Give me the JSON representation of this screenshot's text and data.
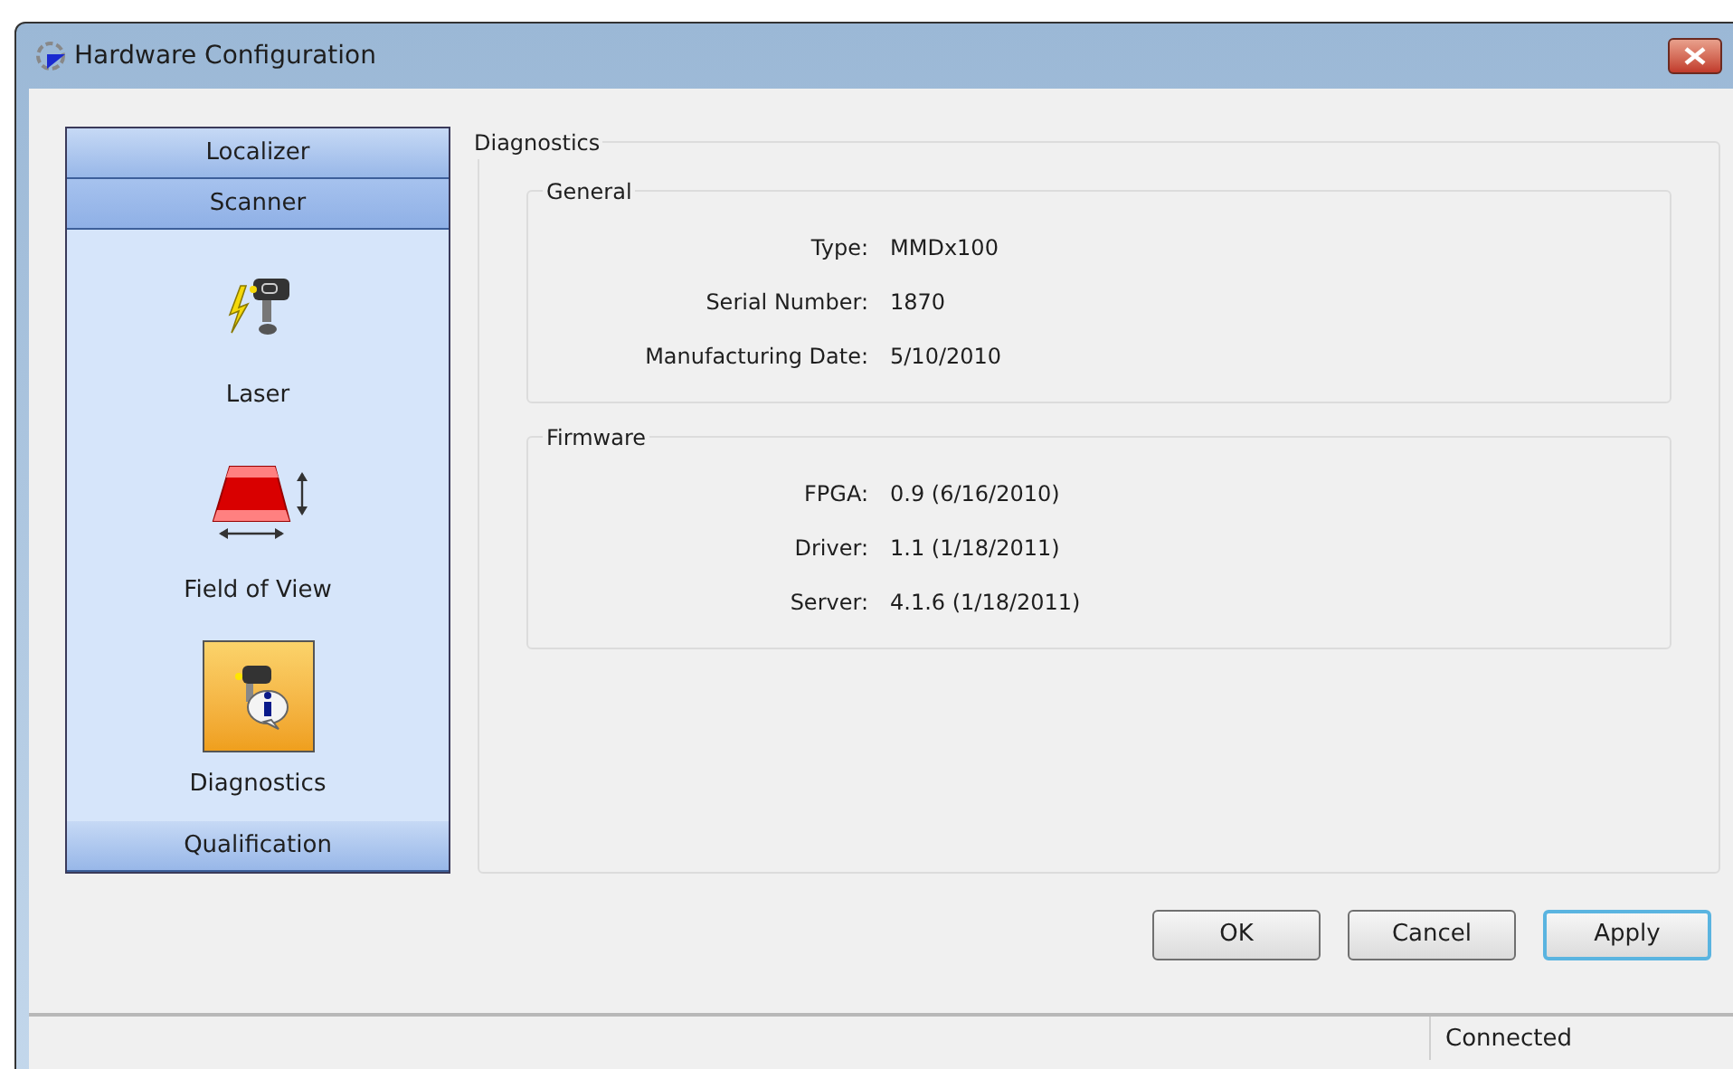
{
  "window": {
    "title": "Hardware Configuration"
  },
  "sidebar": {
    "sections": [
      {
        "label": "Localizer",
        "expanded": false
      },
      {
        "label": "Scanner",
        "expanded": true,
        "items": [
          {
            "label": "Laser",
            "kind": "laser",
            "selected": false
          },
          {
            "label": "Field of View",
            "kind": "field",
            "selected": false
          },
          {
            "label": "Diagnostics",
            "kind": "diagnostics",
            "selected": true
          }
        ]
      },
      {
        "label": "Qualification",
        "expanded": false
      }
    ]
  },
  "panel": {
    "title": "Diagnostics",
    "groups": [
      {
        "title": "General",
        "rows": [
          {
            "label": "Type:",
            "value": "MMDx100"
          },
          {
            "label": "Serial Number:",
            "value": "1870"
          },
          {
            "label": "Manufacturing Date:",
            "value": "5/10/2010"
          }
        ]
      },
      {
        "title": "Firmware",
        "rows": [
          {
            "label": "FPGA:",
            "value": "0.9 (6/16/2010)"
          },
          {
            "label": "Driver:",
            "value": "1.1 (1/18/2011)"
          },
          {
            "label": "Server:",
            "value": "4.1.6 (1/18/2011)"
          }
        ]
      }
    ]
  },
  "buttons": [
    {
      "label": "OK",
      "default": false
    },
    {
      "label": "Cancel",
      "default": false
    },
    {
      "label": "Apply",
      "default": true
    }
  ],
  "status_bar": {
    "text": "Connected"
  }
}
